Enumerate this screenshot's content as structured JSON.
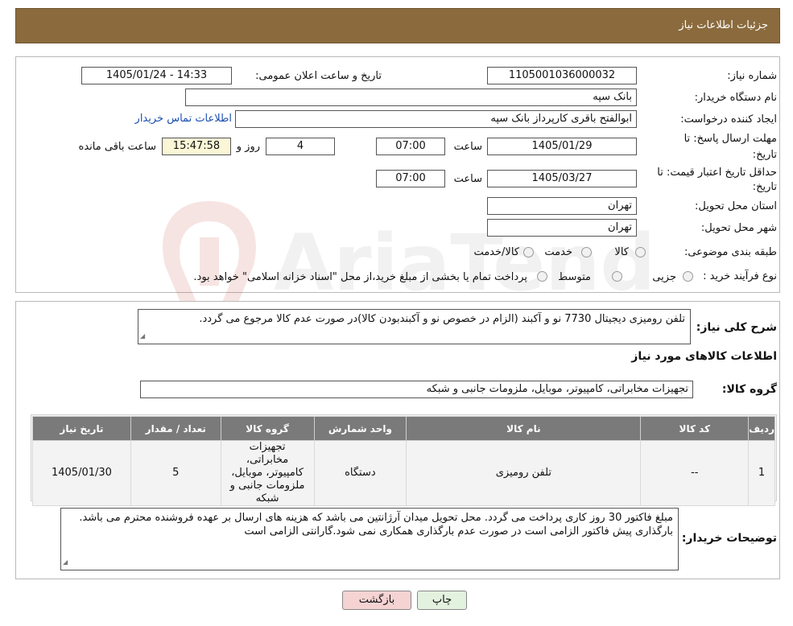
{
  "header": {
    "title": "جزئیات اطلاعات نیاز"
  },
  "form": {
    "need_number_label": "شماره نیاز:",
    "need_number": "1105001036000032",
    "announce_label": "تاریخ و ساعت اعلان عمومی:",
    "announce_value": "1405/01/24 - 14:33",
    "buyer_org_label": "نام دستگاه خریدار:",
    "buyer_org": "بانک سپه",
    "requester_label": "ایجاد کننده درخواست:",
    "requester": "ابوالفتح باقری کارپرداز بانک سپه",
    "contact_link": "اطلاعات تماس خریدار",
    "deadline_label_1": "مهلت ارسال پاسخ: تا",
    "deadline_label_2": "تاریخ:",
    "deadline_date": "1405/01/29",
    "time_label": "ساعت",
    "deadline_time": "07:00",
    "days_value": "4",
    "days_label": "روز و",
    "remaining_time": "15:47:58",
    "remaining_label": "ساعت باقی مانده",
    "validity_label_1": "حداقل تاریخ اعتبار قیمت: تا",
    "validity_label_2": "تاریخ:",
    "validity_date": "1405/03/27",
    "validity_time": "07:00",
    "province_label": "استان محل تحویل:",
    "province": "تهران",
    "city_label": "شهر محل تحویل:",
    "city": "تهران",
    "category_label": "طبقه بندی موضوعی:",
    "category_options": [
      "کالا",
      "خدمت",
      "کالا/خدمت"
    ],
    "purchase_type_label": "نوع فرآیند خرید :",
    "purchase_options": [
      "جزیی",
      "متوسط"
    ],
    "purchase_note": "پرداخت تمام یا بخشی از مبلغ خرید،از محل \"اسناد خزانه اسلامی\" خواهد بود."
  },
  "details": {
    "summary_label": "شرح کلی نیاز:",
    "summary": "تلفن رومیزی دیجیتال 7730 نو و آکبند (الزام در خصوص نو و آکبندبودن کالا)در صورت عدم کالا مرجوع می گردد.",
    "goods_info_title": "اطلاعات کالاهای مورد نیاز",
    "goods_group_label": "گروه کالا:",
    "goods_group": "تجهیزات مخابراتی، کامپیوتر، موبایل، ملزومات جانبی و شبکه"
  },
  "table": {
    "headers": [
      "ردیف",
      "کد کالا",
      "نام کالا",
      "واحد شمارش",
      "گروه کالا",
      "تعداد / مقدار",
      "تاریخ نیاز"
    ],
    "rows": [
      [
        "1",
        "--",
        "تلفن رومیزی",
        "دستگاه",
        "تجهیزات مخابراتی، کامپیوتر، موبایل، ملزومات جانبی و شبکه",
        "5",
        "1405/01/30"
      ]
    ]
  },
  "buyer_notes": {
    "label": "توضیحات خریدار:",
    "text": "مبلغ فاکتور 30 روز کاری پرداخت می گردد. محل تحویل میدان آرژانتین می باشد که هزینه های ارسال بر عهده فروشنده محترم می باشد. بارگذاری پیش فاکتور الزامی است در صورت عدم بارگذاری همکاری نمی شود.گارانتی الزامی است"
  },
  "buttons": {
    "print": "چاپ",
    "back": "بازگشت"
  },
  "colors": {
    "header": "#8b6b3d",
    "table_header": "#7a7a7a",
    "back_button": "#f6d3d3",
    "print_button": "#e3f1df"
  }
}
